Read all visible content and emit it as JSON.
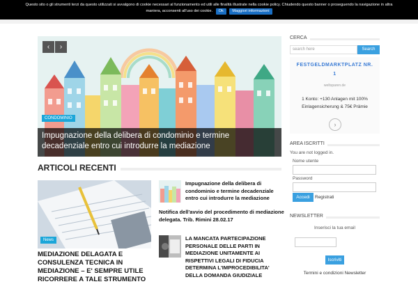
{
  "cookie_banner": {
    "text_line1": "Questo sito o gli strumenti terzi da questo utilizzati si avvalgono di cookie necessari al funzionamento ed utili alle finalità illustrate nella cookie policy. Chiudendo questo banner o proseguendo la navigazione in altra",
    "text_line2": "maniera, acconsenti all'uso dei cookie.",
    "ok_label": "Ok",
    "more_label": "Maggiori informazioni"
  },
  "slider": {
    "prev": "‹",
    "next": "›",
    "category": "CONDOMINIO",
    "caption": "Impugnazione della delibera di condominio e termine decadenziale entro cui introdurre la mediazione"
  },
  "recent": {
    "title": "ARTICOLI RECENTI",
    "featured": {
      "category": "News",
      "title": "MEDIAZIONE DELAGATA E CONSULENZA TECNICA IN MEDIAZIONE – E' SEMPRE UTILE RICORRERE A TALE STRUMENTO"
    },
    "items": [
      {
        "title": "Impugnazione della delibera di condominio e termine decadenziale entro cui introdurre la mediazione"
      },
      {
        "title": "Notifica dell'avvio del procedimento di mediazione delegata. Trib. Rimini 28.02.17"
      },
      {
        "title": "LA MANCATA PARTECIPAZIONE PERSONALE DELLE PARTI IN MEDIAZIONE UNITAMENTE AI RISPETTIVI LEGALI DI FIDUCIA DETERMINA L'IMPROCEDIBILITA' DELLA DOMANDA GIUDIZIALE"
      }
    ]
  },
  "sidebar": {
    "search_title": "CERCA",
    "search_placeholder": "search here",
    "search_button": "Search",
    "ad": {
      "title_line1": "FESTGELDMARKTPLATZ NR.",
      "title_line2": "1",
      "source": "weltsparen.de",
      "body_line1": "1 Konto: +130 Anlagen mit 100%",
      "body_line2": "Einlagensicherung & 75€ Prämie",
      "go": "›"
    },
    "login_title": "AREA ISCRITTI",
    "login_note": "You are not logged in.",
    "username_label": "Nome utente",
    "password_label": "Password",
    "login_button": "Accedi",
    "register_link": "Registrati",
    "newsletter_title": "NEWSLETTER",
    "newsletter_label": "Inserisci la tua email",
    "newsletter_button": "Iscriviti",
    "newsletter_terms": "Termini e condizioni Newsletter"
  },
  "colors": {
    "accent": "#1ba6d9",
    "button": "#3aa0e0"
  }
}
